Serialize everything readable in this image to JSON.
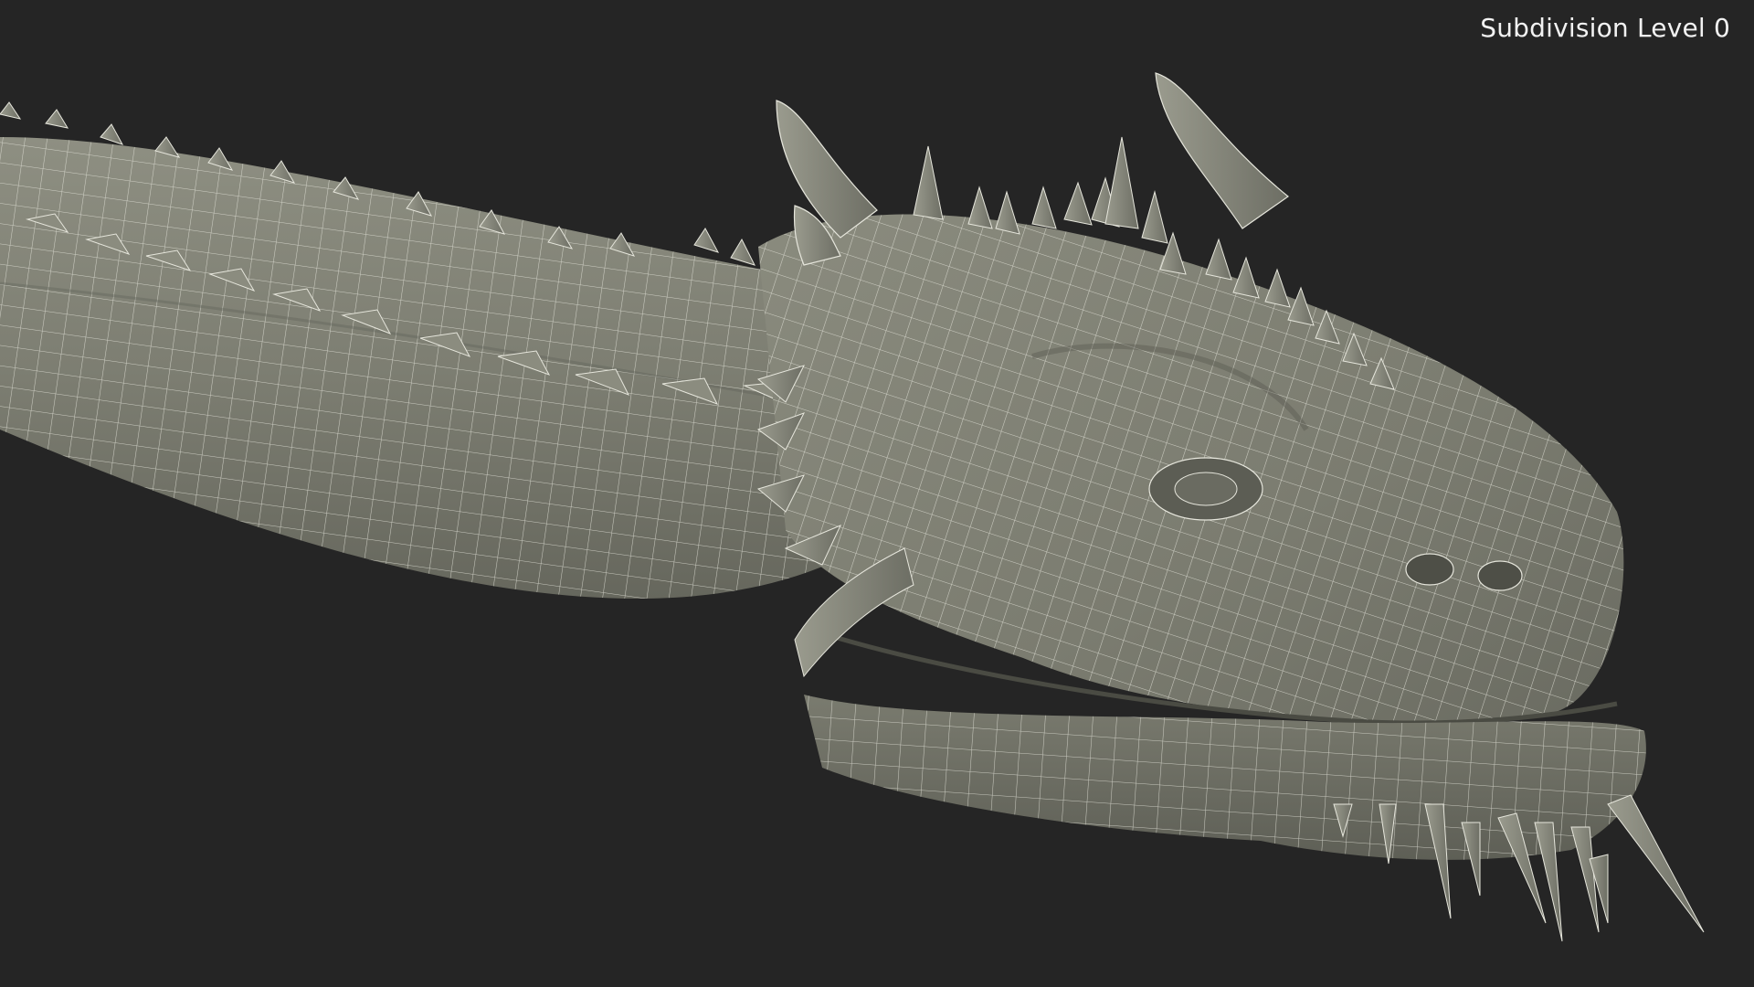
{
  "overlay": {
    "subdivision_label": "Subdivision Level 0"
  },
  "render": {
    "subject": "dragon-head-wireframe",
    "colors": {
      "background": "#252525",
      "surface": "#7d7e72",
      "surface_light": "#8f9083",
      "surface_dark": "#5f6057",
      "wire": "#e8e8df",
      "spike": "#8a8b7e"
    }
  }
}
